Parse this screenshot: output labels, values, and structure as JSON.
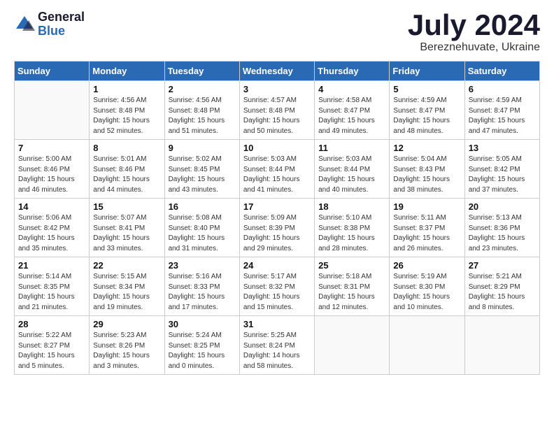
{
  "header": {
    "logo": {
      "general": "General",
      "blue": "Blue"
    },
    "title": "July 2024",
    "location": "Bereznehuvate, Ukraine"
  },
  "calendar": {
    "days_of_week": [
      "Sunday",
      "Monday",
      "Tuesday",
      "Wednesday",
      "Thursday",
      "Friday",
      "Saturday"
    ],
    "weeks": [
      [
        {
          "day": "",
          "info": ""
        },
        {
          "day": "1",
          "info": "Sunrise: 4:56 AM\nSunset: 8:48 PM\nDaylight: 15 hours\nand 52 minutes."
        },
        {
          "day": "2",
          "info": "Sunrise: 4:56 AM\nSunset: 8:48 PM\nDaylight: 15 hours\nand 51 minutes."
        },
        {
          "day": "3",
          "info": "Sunrise: 4:57 AM\nSunset: 8:48 PM\nDaylight: 15 hours\nand 50 minutes."
        },
        {
          "day": "4",
          "info": "Sunrise: 4:58 AM\nSunset: 8:47 PM\nDaylight: 15 hours\nand 49 minutes."
        },
        {
          "day": "5",
          "info": "Sunrise: 4:59 AM\nSunset: 8:47 PM\nDaylight: 15 hours\nand 48 minutes."
        },
        {
          "day": "6",
          "info": "Sunrise: 4:59 AM\nSunset: 8:47 PM\nDaylight: 15 hours\nand 47 minutes."
        }
      ],
      [
        {
          "day": "7",
          "info": "Sunrise: 5:00 AM\nSunset: 8:46 PM\nDaylight: 15 hours\nand 46 minutes."
        },
        {
          "day": "8",
          "info": "Sunrise: 5:01 AM\nSunset: 8:46 PM\nDaylight: 15 hours\nand 44 minutes."
        },
        {
          "day": "9",
          "info": "Sunrise: 5:02 AM\nSunset: 8:45 PM\nDaylight: 15 hours\nand 43 minutes."
        },
        {
          "day": "10",
          "info": "Sunrise: 5:03 AM\nSunset: 8:44 PM\nDaylight: 15 hours\nand 41 minutes."
        },
        {
          "day": "11",
          "info": "Sunrise: 5:03 AM\nSunset: 8:44 PM\nDaylight: 15 hours\nand 40 minutes."
        },
        {
          "day": "12",
          "info": "Sunrise: 5:04 AM\nSunset: 8:43 PM\nDaylight: 15 hours\nand 38 minutes."
        },
        {
          "day": "13",
          "info": "Sunrise: 5:05 AM\nSunset: 8:42 PM\nDaylight: 15 hours\nand 37 minutes."
        }
      ],
      [
        {
          "day": "14",
          "info": "Sunrise: 5:06 AM\nSunset: 8:42 PM\nDaylight: 15 hours\nand 35 minutes."
        },
        {
          "day": "15",
          "info": "Sunrise: 5:07 AM\nSunset: 8:41 PM\nDaylight: 15 hours\nand 33 minutes."
        },
        {
          "day": "16",
          "info": "Sunrise: 5:08 AM\nSunset: 8:40 PM\nDaylight: 15 hours\nand 31 minutes."
        },
        {
          "day": "17",
          "info": "Sunrise: 5:09 AM\nSunset: 8:39 PM\nDaylight: 15 hours\nand 29 minutes."
        },
        {
          "day": "18",
          "info": "Sunrise: 5:10 AM\nSunset: 8:38 PM\nDaylight: 15 hours\nand 28 minutes."
        },
        {
          "day": "19",
          "info": "Sunrise: 5:11 AM\nSunset: 8:37 PM\nDaylight: 15 hours\nand 26 minutes."
        },
        {
          "day": "20",
          "info": "Sunrise: 5:13 AM\nSunset: 8:36 PM\nDaylight: 15 hours\nand 23 minutes."
        }
      ],
      [
        {
          "day": "21",
          "info": "Sunrise: 5:14 AM\nSunset: 8:35 PM\nDaylight: 15 hours\nand 21 minutes."
        },
        {
          "day": "22",
          "info": "Sunrise: 5:15 AM\nSunset: 8:34 PM\nDaylight: 15 hours\nand 19 minutes."
        },
        {
          "day": "23",
          "info": "Sunrise: 5:16 AM\nSunset: 8:33 PM\nDaylight: 15 hours\nand 17 minutes."
        },
        {
          "day": "24",
          "info": "Sunrise: 5:17 AM\nSunset: 8:32 PM\nDaylight: 15 hours\nand 15 minutes."
        },
        {
          "day": "25",
          "info": "Sunrise: 5:18 AM\nSunset: 8:31 PM\nDaylight: 15 hours\nand 12 minutes."
        },
        {
          "day": "26",
          "info": "Sunrise: 5:19 AM\nSunset: 8:30 PM\nDaylight: 15 hours\nand 10 minutes."
        },
        {
          "day": "27",
          "info": "Sunrise: 5:21 AM\nSunset: 8:29 PM\nDaylight: 15 hours\nand 8 minutes."
        }
      ],
      [
        {
          "day": "28",
          "info": "Sunrise: 5:22 AM\nSunset: 8:27 PM\nDaylight: 15 hours\nand 5 minutes."
        },
        {
          "day": "29",
          "info": "Sunrise: 5:23 AM\nSunset: 8:26 PM\nDaylight: 15 hours\nand 3 minutes."
        },
        {
          "day": "30",
          "info": "Sunrise: 5:24 AM\nSunset: 8:25 PM\nDaylight: 15 hours\nand 0 minutes."
        },
        {
          "day": "31",
          "info": "Sunrise: 5:25 AM\nSunset: 8:24 PM\nDaylight: 14 hours\nand 58 minutes."
        },
        {
          "day": "",
          "info": ""
        },
        {
          "day": "",
          "info": ""
        },
        {
          "day": "",
          "info": ""
        }
      ]
    ]
  }
}
